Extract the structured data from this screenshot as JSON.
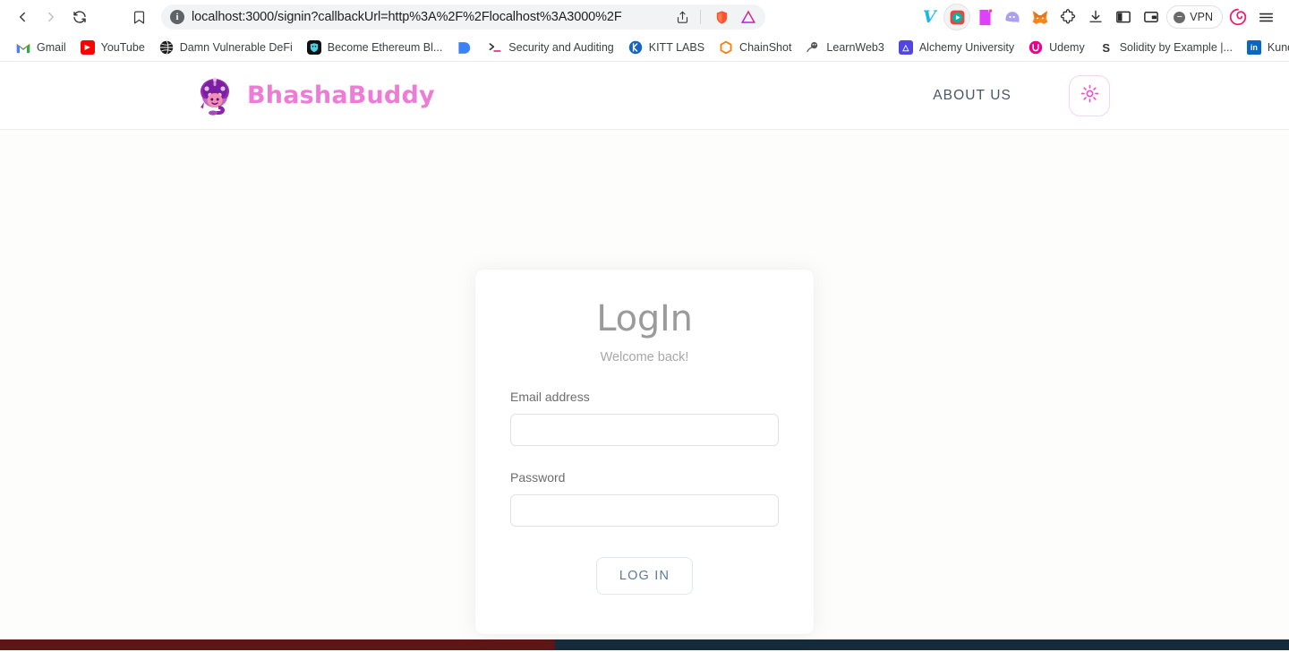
{
  "browser": {
    "nav": {
      "back_icon": "chevron-left-icon",
      "forward_icon": "chevron-right-icon",
      "reload_icon": "reload-icon",
      "bookmark_icon": "bookmark-icon"
    },
    "address_bar": {
      "info_icon": "info-icon",
      "url": "localhost:3000/signin?callbackUrl=http%3A%2F%2Flocalhost%3A3000%2F",
      "url_host": "localhost",
      "url_rest": ":3000/signin?callbackUrl=http%3A%2F%2Flocalhost%3A3000%2F",
      "share_icon": "share-icon"
    },
    "extensions": [
      {
        "name": "vimeo-extension-icon",
        "glyph": "V",
        "color": "#1ab7ea"
      },
      {
        "name": "screen-recorder-extension-icon",
        "glyph": "●",
        "color": "#e8453c"
      },
      {
        "name": "notebook-extension-icon",
        "glyph": "▮",
        "color": "#e040fb"
      },
      {
        "name": "phantom-wallet-extension-icon",
        "glyph": "◗",
        "color": "#ab9ff2"
      },
      {
        "name": "metamask-extension-icon",
        "glyph": "◆",
        "color": "#f6851b"
      },
      {
        "name": "puzzle-extensions-icon",
        "glyph": "✲",
        "color": "#3b3b3b"
      },
      {
        "name": "downloads-icon",
        "glyph": "⤓",
        "color": "#3b3b3b"
      },
      {
        "name": "sidebar-toggle-icon",
        "glyph": "■",
        "color": "#2b2b2b"
      },
      {
        "name": "wallet-icon",
        "glyph": "▣",
        "color": "#2b2b2b"
      }
    ],
    "vpn": {
      "label": "VPN",
      "icon": "vpn-status-icon"
    },
    "profile_icon": "profile-avatar-icon",
    "menu_icon": "hamburger-menu-icon",
    "bookmarks": [
      {
        "label": "Gmail",
        "icon": "gmail-icon",
        "glyph": "M",
        "color": "#ea4335",
        "bg": "#ffffff"
      },
      {
        "label": "YouTube",
        "icon": "youtube-icon",
        "glyph": "▶",
        "color": "#ffffff",
        "bg": "#ff0000"
      },
      {
        "label": "Damn Vulnerable DeFi",
        "icon": "globe-icon",
        "glyph": "●",
        "color": "#ffffff",
        "bg": "#1a1a1a"
      },
      {
        "label": "Become Ethereum Bl...",
        "icon": "shield-icon",
        "glyph": "▼",
        "color": "#4dd0e1",
        "bg": "#111111"
      },
      {
        "label": "",
        "icon": "blue-folder-icon",
        "glyph": "◖",
        "color": "#3b82f6",
        "bg": "#ffffff"
      },
      {
        "label": "Security and Auditing",
        "icon": "terminal-icon",
        "glyph": "❯",
        "color": "#e91e63",
        "bg": "#ffffff"
      },
      {
        "label": "KITT LABS",
        "icon": "kitt-labs-icon",
        "glyph": "K",
        "color": "#ffffff",
        "bg": "#1565c0"
      },
      {
        "label": "ChainShot",
        "icon": "chainshot-icon",
        "glyph": "⬡",
        "color": "#ff7a00",
        "bg": "#ffffff"
      },
      {
        "label": "LearnWeb3",
        "icon": "learnweb3-icon",
        "glyph": "◔",
        "color": "#444444",
        "bg": "#ffffff"
      },
      {
        "label": "Alchemy University",
        "icon": "alchemy-icon",
        "glyph": "A",
        "color": "#ffffff",
        "bg": "#4f46e5"
      },
      {
        "label": "Udemy",
        "icon": "udemy-icon",
        "glyph": "U",
        "color": "#ffffff",
        "bg": "#ec008c"
      },
      {
        "label": "Solidity by Example |...",
        "icon": "solidity-icon",
        "glyph": "S",
        "color": "#2b2b2b",
        "bg": "#ffffff"
      },
      {
        "label": "Kundan Kumar | Linke...",
        "icon": "linkedin-icon",
        "glyph": "in",
        "color": "#ffffff",
        "bg": "#0a66c2"
      }
    ],
    "bookmarks_overflow": "»"
  },
  "site": {
    "brand": {
      "name": "BhashaBuddy",
      "logo_icon": "bhashabuddy-mascot-logo",
      "color": "#ee7bd6"
    },
    "nav": {
      "about_us": "ABOUT US"
    },
    "theme_toggle": {
      "icon": "sun-icon",
      "color": "#f050c8"
    }
  },
  "login": {
    "title": "LogIn",
    "subtitle": "Welcome back!",
    "email": {
      "label": "Email address",
      "value": "",
      "placeholder": ""
    },
    "password": {
      "label": "Password",
      "value": "",
      "placeholder": ""
    },
    "submit_label": "LOG IN"
  },
  "os_bar": {
    "left_color": "#5c1616",
    "right_color": "#152a3a"
  }
}
